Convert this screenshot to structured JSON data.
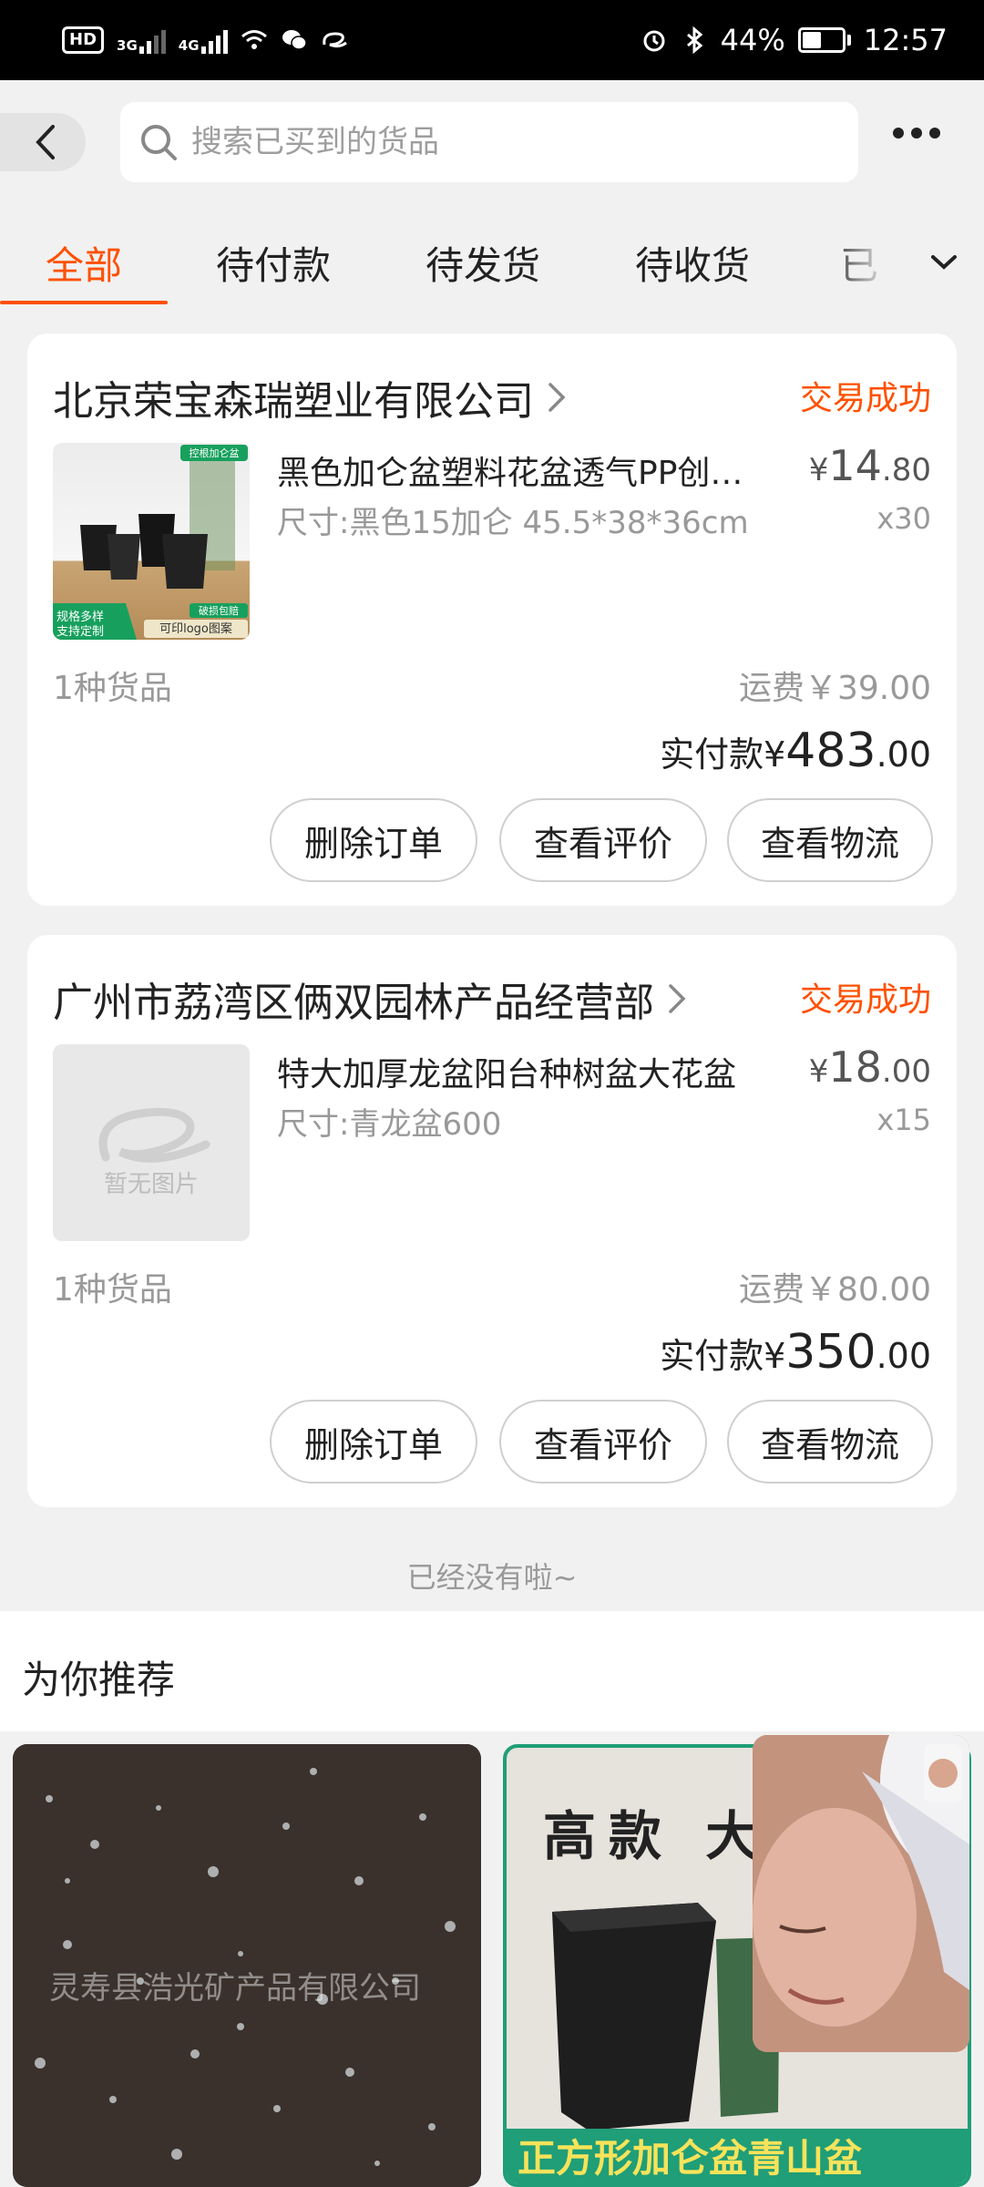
{
  "status_bar": {
    "hd": "HD",
    "sim1": "3G",
    "sim2": "4G",
    "battery_pct": "44%",
    "time": "12:57"
  },
  "header": {
    "search_placeholder": "搜索已买到的货品"
  },
  "tabs": [
    {
      "label": "全部",
      "active": true
    },
    {
      "label": "待付款",
      "active": false
    },
    {
      "label": "待发货",
      "active": false
    },
    {
      "label": "待收货",
      "active": false
    },
    {
      "label": "已",
      "active": false
    }
  ],
  "orders": [
    {
      "shop": "北京荣宝森瑞塑业有限公司",
      "status": "交易成功",
      "item_title": "黑色加仑盆塑料花盆透气PP创…",
      "item_spec": "尺寸:黑色15加仑 45.5*38*36cm",
      "price_symbol": "¥",
      "price_int": "14",
      "price_dec": ".80",
      "qty": "x30",
      "count_text": "1种货品",
      "freight": "运费￥39.00",
      "total_label": "实付款",
      "total_symbol": "¥",
      "total_int": "483",
      "total_dec": ".00",
      "thumb_badges": [
        "控根加仑盆",
        "规格多样",
        "支持定制",
        "破损包赔",
        "可印logo图案"
      ],
      "buttons": [
        "删除订单",
        "查看评价",
        "查看物流"
      ]
    },
    {
      "shop": "广州市荔湾区俩双园林产品经营部",
      "status": "交易成功",
      "item_title": "特大加厚龙盆阳台种树盆大花盆",
      "item_spec": "尺寸:青龙盆600",
      "price_symbol": "¥",
      "price_int": "18",
      "price_dec": ".00",
      "qty": "x15",
      "count_text": "1种货品",
      "freight": "运费￥80.00",
      "total_label": "实付款",
      "total_symbol": "¥",
      "total_int": "350",
      "total_dec": ".00",
      "thumb_placeholder": "暂无图片",
      "buttons": [
        "删除订单",
        "查看评价",
        "查看物流"
      ]
    }
  ],
  "no_more_text": "已经没有啦~",
  "recommend": {
    "title": "为你推荐",
    "card1_watermark": "灵寿县浩光矿产品有限公司",
    "card2_headline": "高款 大",
    "card2_banner": "正方形加仑盆青山盆"
  },
  "colors": {
    "accent": "#ff5000",
    "background": "#f1f1f1",
    "card": "#ffffff",
    "muted_text": "#999999"
  }
}
